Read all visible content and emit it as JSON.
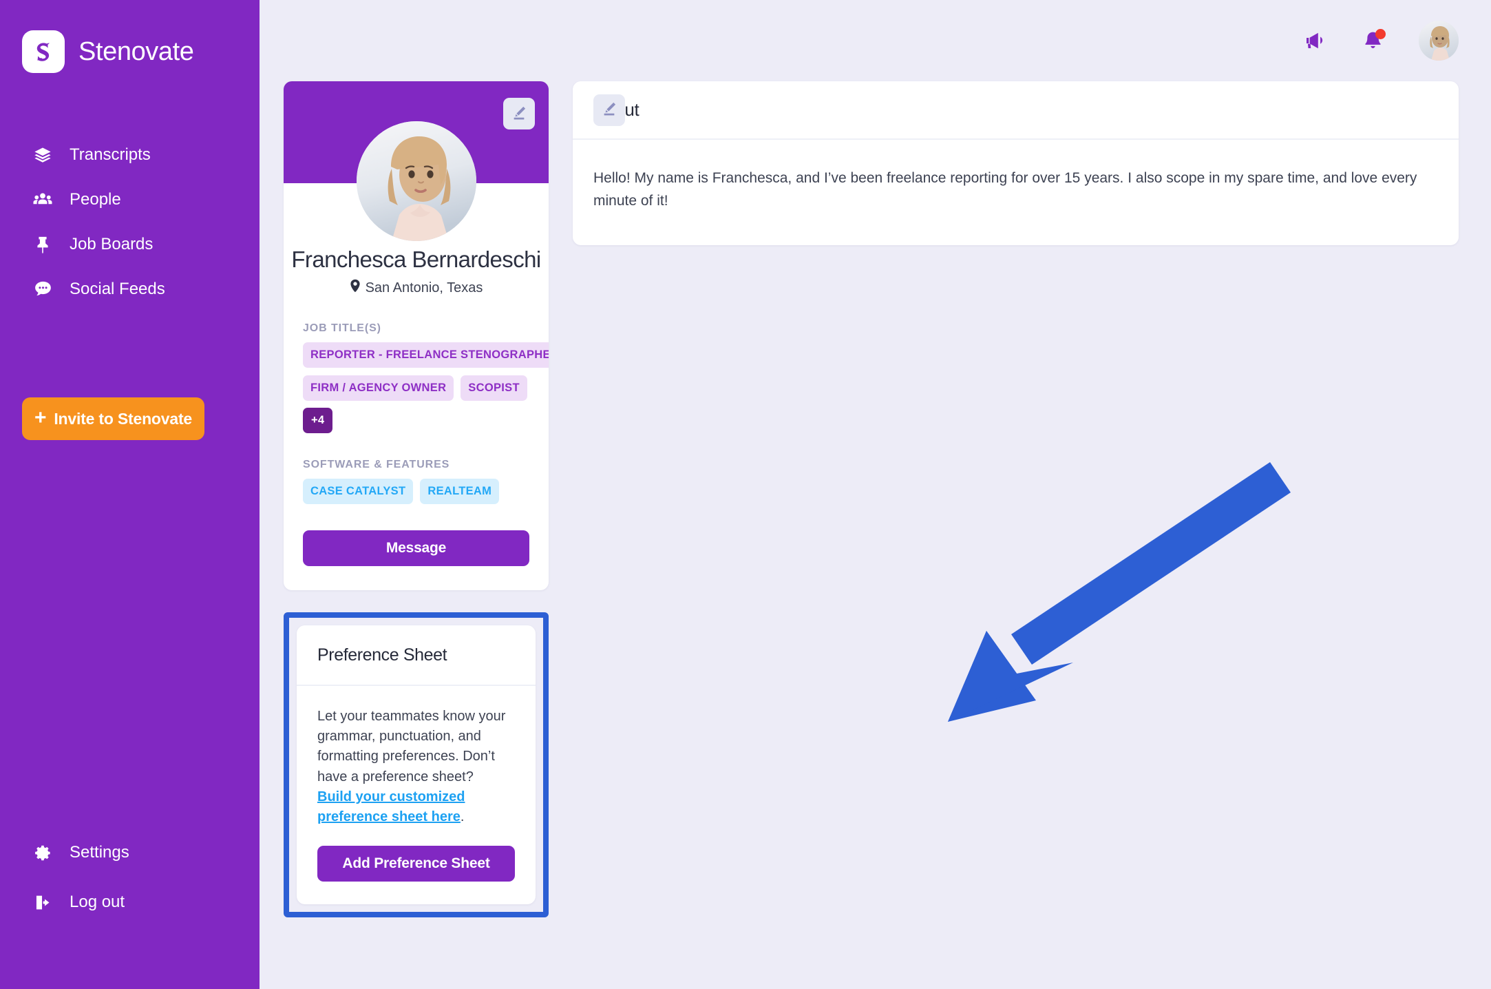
{
  "brand": {
    "name": "Stenovate",
    "logo_icon": "stenovate-s-logo"
  },
  "sidebar": {
    "items": [
      {
        "label": "Transcripts",
        "icon": "layers-icon"
      },
      {
        "label": "People",
        "icon": "people-group-icon"
      },
      {
        "label": "Job Boards",
        "icon": "pushpin-icon"
      },
      {
        "label": "Social Feeds",
        "icon": "chat-bubble-icon"
      }
    ],
    "invite_button": "Invite to Stenovate",
    "invite_plus": "+",
    "bottom_items": [
      {
        "label": "Settings",
        "icon": "gear-icon"
      },
      {
        "label": "Log out",
        "icon": "logout-icon"
      }
    ]
  },
  "topbar": {
    "announcement_icon": "megaphone-icon",
    "notifications_icon": "bell-icon",
    "has_notification_dot": true,
    "avatar_icon": "user-avatar"
  },
  "profile": {
    "edit_icon": "edit-pencil-icon",
    "avatar_icon": "user-avatar-large",
    "name": "Franchesca Bernardeschi",
    "location": "San Antonio, Texas",
    "location_icon": "map-pin-icon",
    "job_titles_label": "JOB TITLE(S)",
    "job_titles": [
      "REPORTER - FREELANCE STENOGRAPHER",
      "FIRM / AGENCY OWNER",
      "SCOPIST"
    ],
    "job_titles_more": "+4",
    "software_label": "SOFTWARE & FEATURES",
    "software": [
      "CASE CATALYST",
      "REALTEAM"
    ],
    "message_button": "Message"
  },
  "preference_sheet": {
    "title": "Preference Sheet",
    "description_part1": "Let your teammates know your grammar, punctuation, and formatting preferences. Don’t have a preference sheet?  ",
    "link_text": "Build your customized preference sheet here",
    "description_part2": ".",
    "button": "Add Preference Sheet"
  },
  "about": {
    "title": "About",
    "edit_icon": "edit-pencil-icon",
    "body": "Hello!  My name is Franchesca, and I’ve been freelance reporting for over 15 years.  I also scope in my spare time, and love every minute of it!"
  },
  "annotation": {
    "arrow_icon": "blue-arrow-pointing-to-preference-sheet",
    "highlight_icon": "blue-highlight-box",
    "color": "#2d5fd4"
  },
  "colors": {
    "brand_purple": "#8128c2",
    "accent_orange": "#f7921e",
    "page_background": "#edecf7",
    "job_tag_bg": "#eedcf7",
    "job_tag_text": "#8e2fc5",
    "software_tag_bg": "#d6effd",
    "software_tag_text": "#23a8f6",
    "link_blue": "#1da1f2",
    "annotation_blue": "#2d5fd4",
    "notification_red": "#f33a2e"
  }
}
